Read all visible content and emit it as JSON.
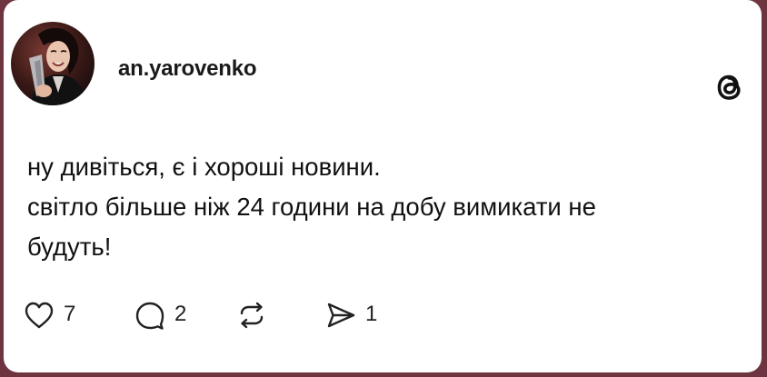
{
  "post": {
    "username": "an.yarovenko",
    "text_lines": [
      "ну дивіться, є і хороші новини.",
      "світло більше ніж 24 години на добу вимикати не",
      "будуть!"
    ]
  },
  "actions": {
    "like": {
      "icon": "heart-icon",
      "count": "7"
    },
    "comment": {
      "icon": "comment-bubble-icon",
      "count": "2"
    },
    "repost": {
      "icon": "repost-icon"
    },
    "share": {
      "icon": "send-icon",
      "count": "1"
    }
  },
  "colors": {
    "background": "#6e3540",
    "card": "#ffffff",
    "text": "#111111",
    "icon": "#222222"
  },
  "brand_icon": "threads-logo-icon"
}
